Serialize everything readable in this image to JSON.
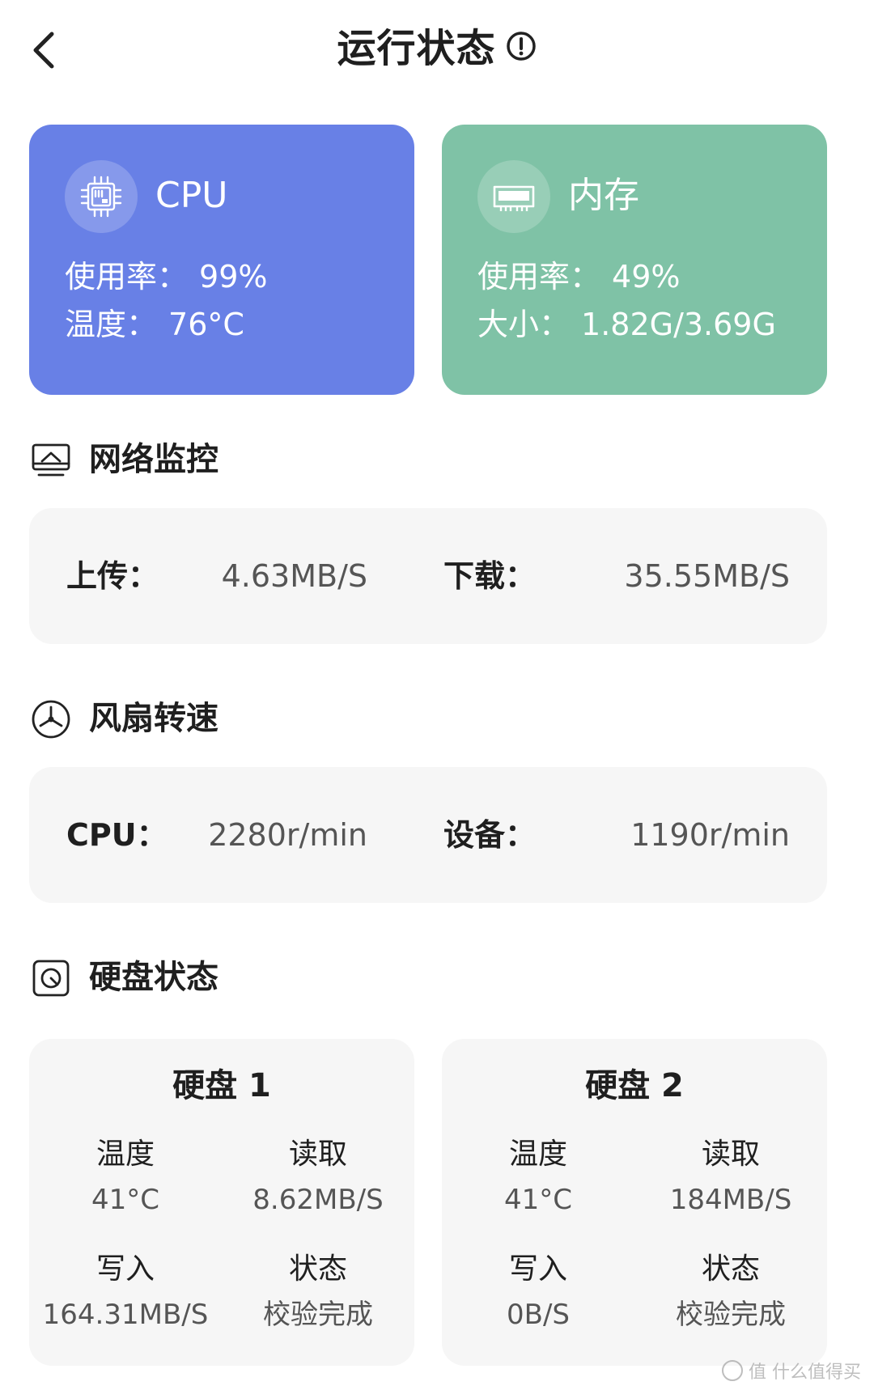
{
  "header": {
    "title": "运行状态"
  },
  "cpu_card": {
    "title": "CPU",
    "usage_label": "使用率：",
    "usage_value": "99%",
    "temp_label": "温度：",
    "temp_value": "76°C",
    "color": "#6880e6"
  },
  "memory_card": {
    "title": "内存",
    "usage_label": "使用率：",
    "usage_value": "49%",
    "size_label": "大小：",
    "size_value": "1.82G/3.69G",
    "color": "#7fc2a6"
  },
  "network": {
    "title": "网络监控",
    "upload_label": "上传：",
    "upload_value": "4.63MB/S",
    "download_label": "下载：",
    "download_value": "35.55MB/S"
  },
  "fan": {
    "title": "风扇转速",
    "cpu_label": "CPU：",
    "cpu_value": "2280r/min",
    "device_label": "设备：",
    "device_value": "1190r/min"
  },
  "disk": {
    "title": "硬盘状态",
    "items": [
      {
        "name": "硬盘 1",
        "temp_label": "温度",
        "temp_value": "41°C",
        "read_label": "读取",
        "read_value": "8.62MB/S",
        "write_label": "写入",
        "write_value": "164.31MB/S",
        "status_label": "状态",
        "status_value": "校验完成"
      },
      {
        "name": "硬盘 2",
        "temp_label": "温度",
        "temp_value": "41°C",
        "read_label": "读取",
        "read_value": "184MB/S",
        "write_label": "写入",
        "write_value": "0B/S",
        "status_label": "状态",
        "status_value": "校验完成"
      }
    ]
  },
  "watermark": {
    "text": "值 什么值得买"
  }
}
